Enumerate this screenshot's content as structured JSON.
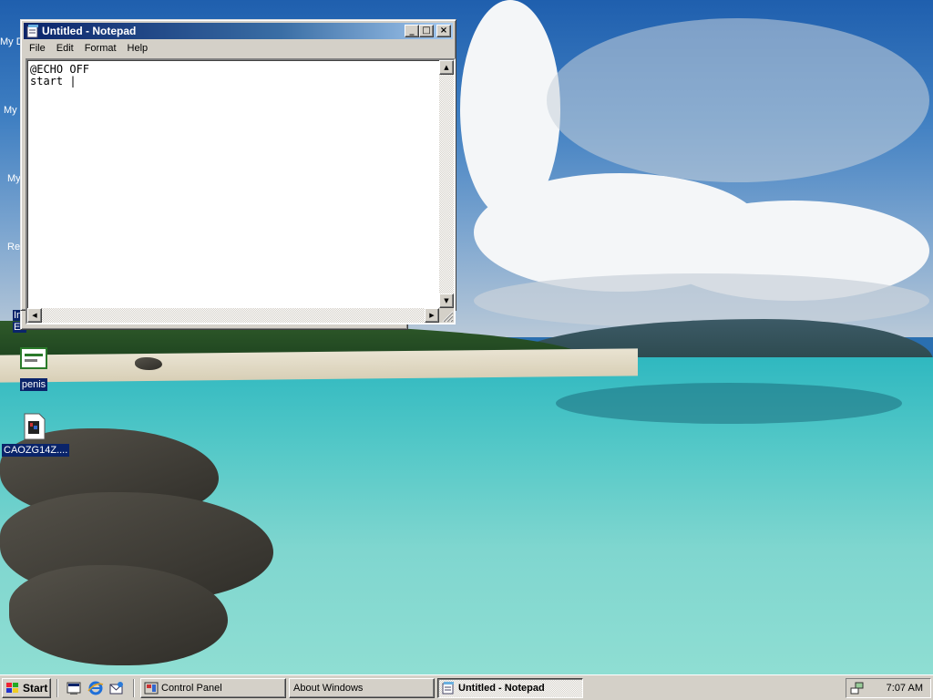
{
  "desktop": {
    "left_labels": [
      "My D",
      "My",
      "My",
      "Re",
      "Int",
      "Ex"
    ],
    "icons": [
      {
        "label": "penis",
        "icon": "document-icon",
        "selected": true
      },
      {
        "label": "CAOZG14Z....",
        "icon": "image-file-icon",
        "selected": true
      }
    ]
  },
  "notepad": {
    "title": "Untitled - Notepad",
    "menu": [
      "File",
      "Edit",
      "Format",
      "Help"
    ],
    "content": "@ECHO OFF\nstart |",
    "buttons": {
      "minimize": "_",
      "maximize": "□",
      "close": "×"
    }
  },
  "taskbar": {
    "start_label": "Start",
    "quick_launch": [
      "show-desktop-icon",
      "internet-explorer-icon",
      "outlook-express-icon"
    ],
    "tasks": [
      {
        "label": "Control Panel",
        "active": false
      },
      {
        "label": "About Windows",
        "active": false
      },
      {
        "label": "Untitled - Notepad",
        "active": true
      }
    ],
    "clock": "7:07 AM"
  },
  "colors": {
    "titlebar_active": "#0a246a",
    "face": "#d4d0c8"
  }
}
